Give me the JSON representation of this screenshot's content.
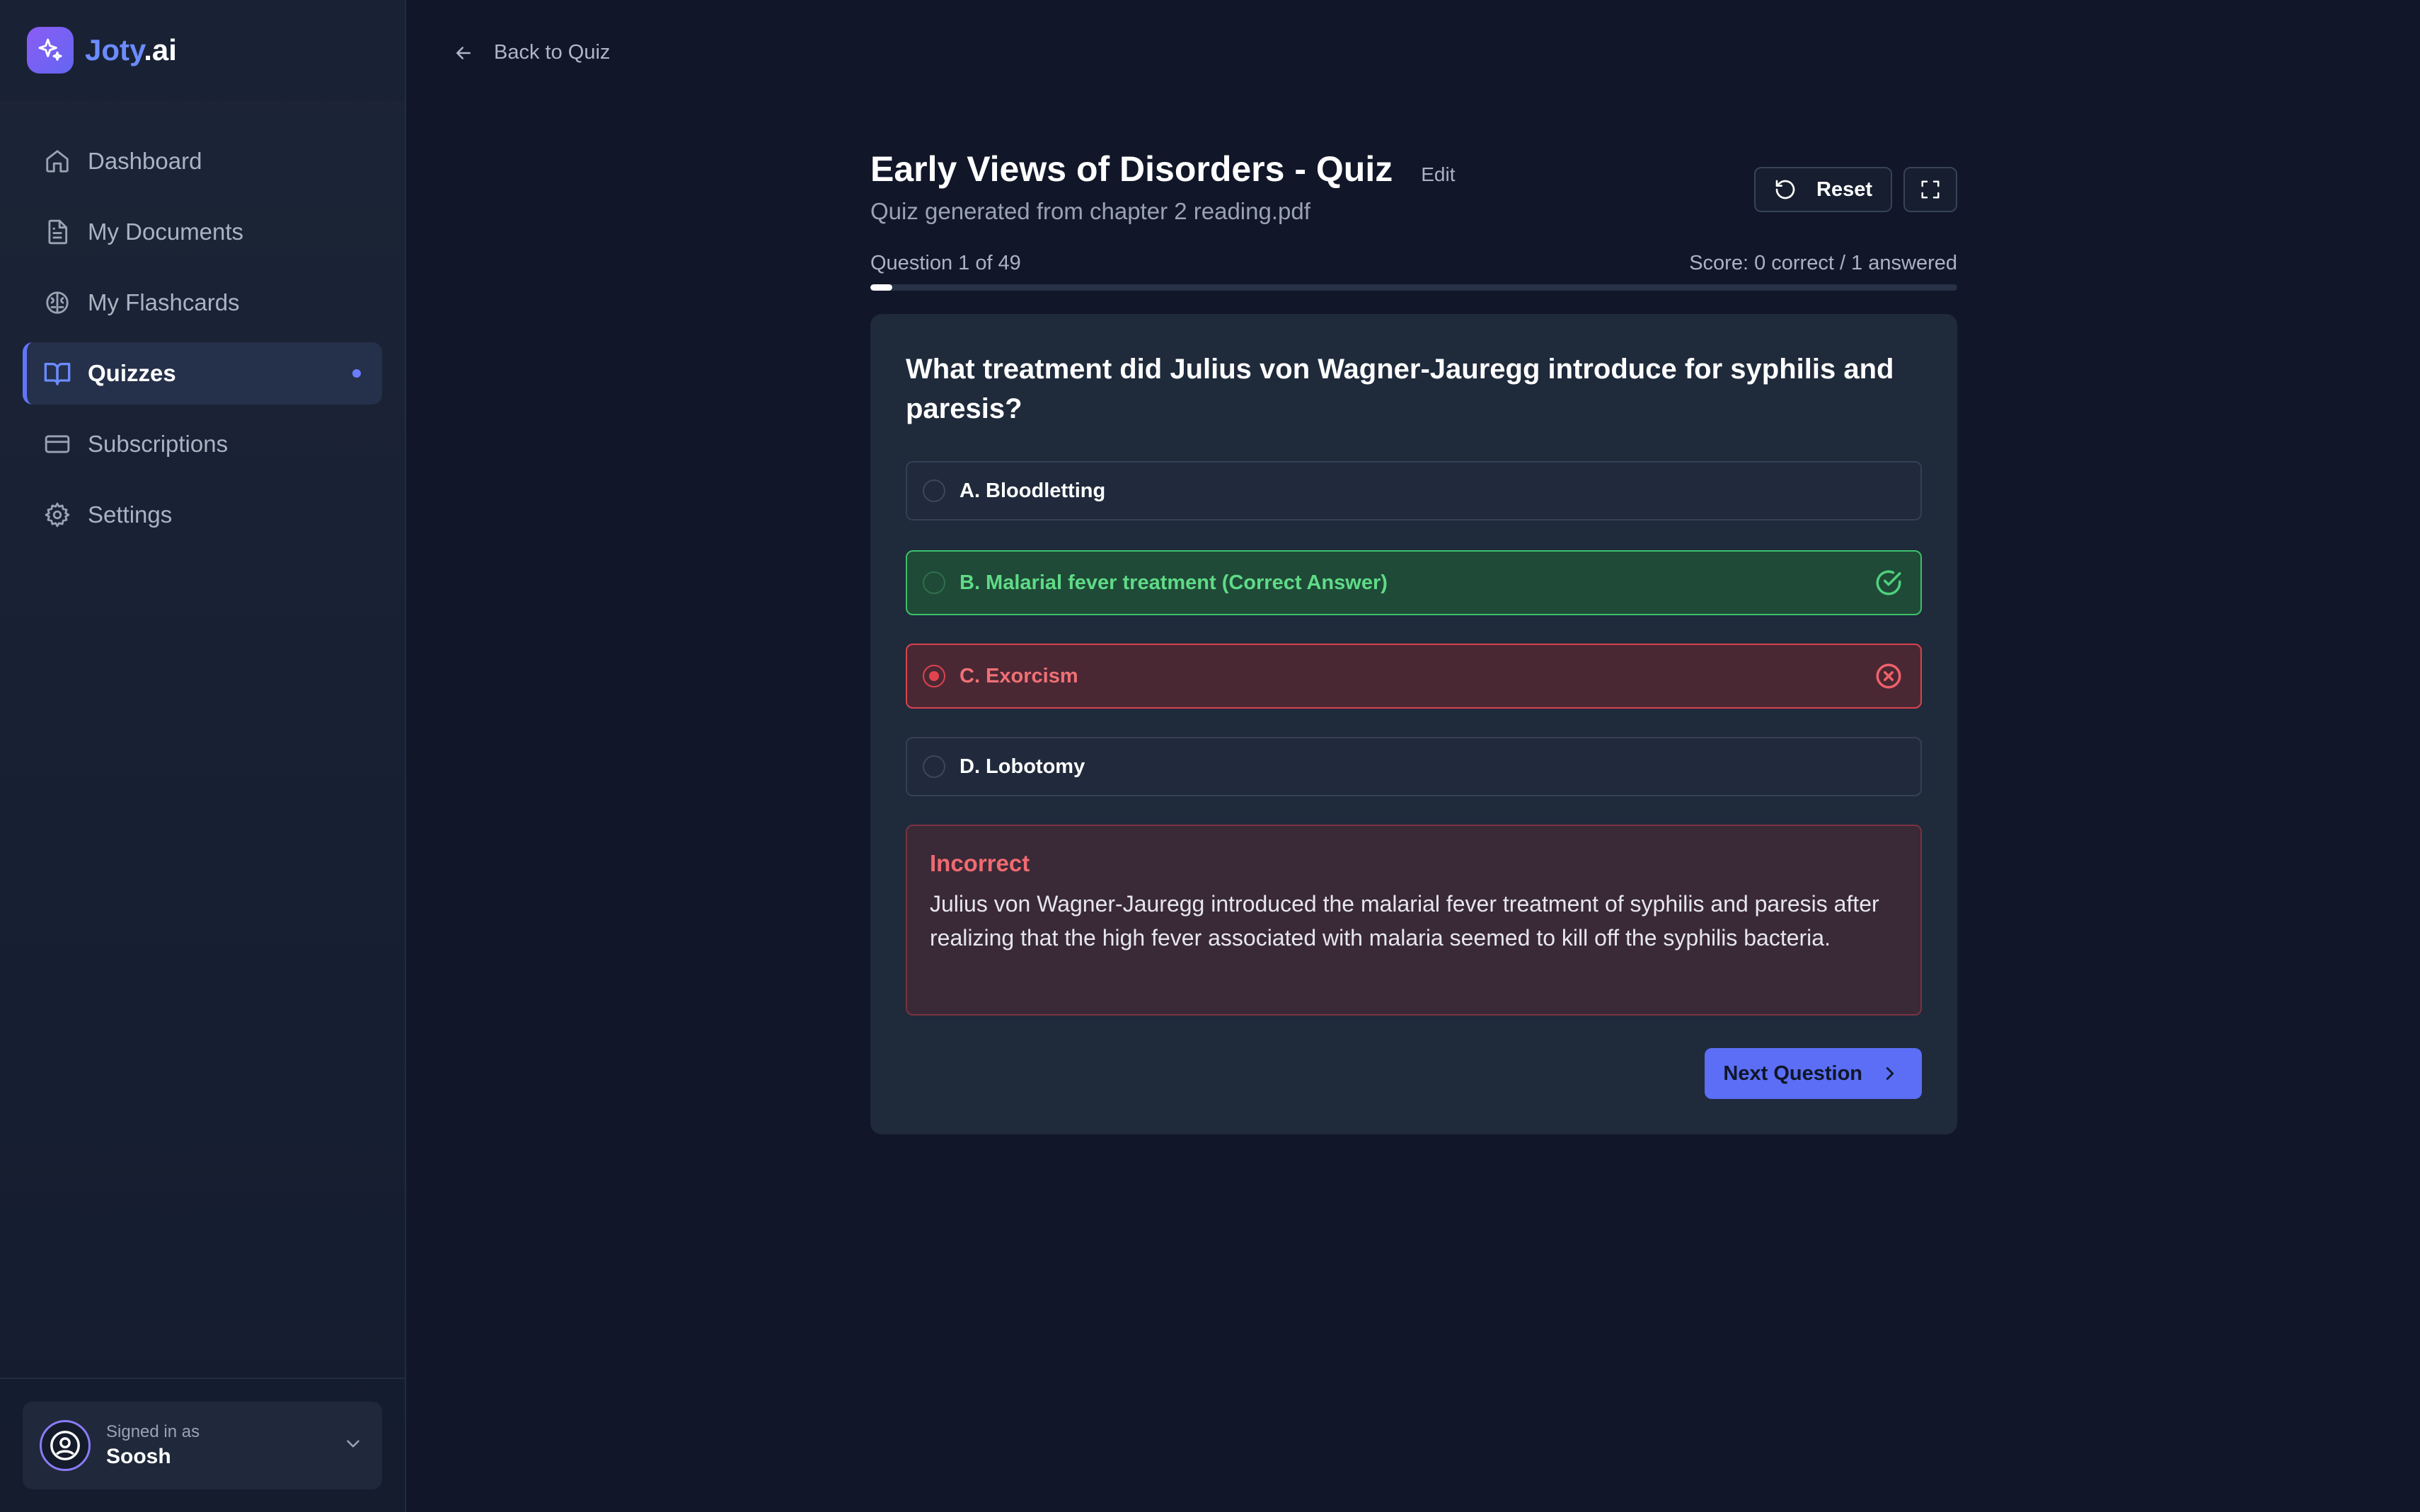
{
  "brand": {
    "name_main": "Joty",
    "name_suffix": ".ai"
  },
  "sidebar": {
    "items": [
      {
        "label": "Dashboard",
        "icon": "home-icon",
        "active": false
      },
      {
        "label": "My Documents",
        "icon": "document-icon",
        "active": false
      },
      {
        "label": "My Flashcards",
        "icon": "brain-icon",
        "active": false
      },
      {
        "label": "Quizzes",
        "icon": "book-open-icon",
        "active": true
      },
      {
        "label": "Subscriptions",
        "icon": "credit-card-icon",
        "active": false
      },
      {
        "label": "Settings",
        "icon": "gear-icon",
        "active": false
      }
    ]
  },
  "user": {
    "signed_in_label": "Signed in as",
    "name": "Soosh"
  },
  "nav": {
    "back_label": "Back to Quiz"
  },
  "quiz": {
    "title": "Early Views of Disorders - Quiz",
    "edit_label": "Edit",
    "subtitle": "Quiz generated from chapter 2 reading.pdf",
    "reset_label": "Reset",
    "progress_text": "Question 1 of 49",
    "score_text": "Score: 0 correct / 1 answered",
    "progress_fraction": 0.0204
  },
  "question": {
    "text": "What treatment did Julius von Wagner-Jauregg introduce for syphilis and paresis?",
    "options": [
      {
        "label": "A. Bloodletting",
        "state": "neutral"
      },
      {
        "label": "B. Malarial fever treatment (Correct Answer)",
        "state": "correct"
      },
      {
        "label": "C. Exorcism",
        "state": "wrong-selected"
      },
      {
        "label": "D. Lobotomy",
        "state": "neutral"
      }
    ]
  },
  "feedback": {
    "title": "Incorrect",
    "text": "Julius von Wagner-Jauregg introduced the malarial fever treatment of syphilis and paresis after realizing that the high fever associated with malaria seemed to kill off the syphilis bacteria."
  },
  "actions": {
    "next_label": "Next Question"
  },
  "colors": {
    "accent": "#5b6ef5",
    "correct": "#3cc06c",
    "wrong": "#d9434f",
    "background": "#111729"
  }
}
